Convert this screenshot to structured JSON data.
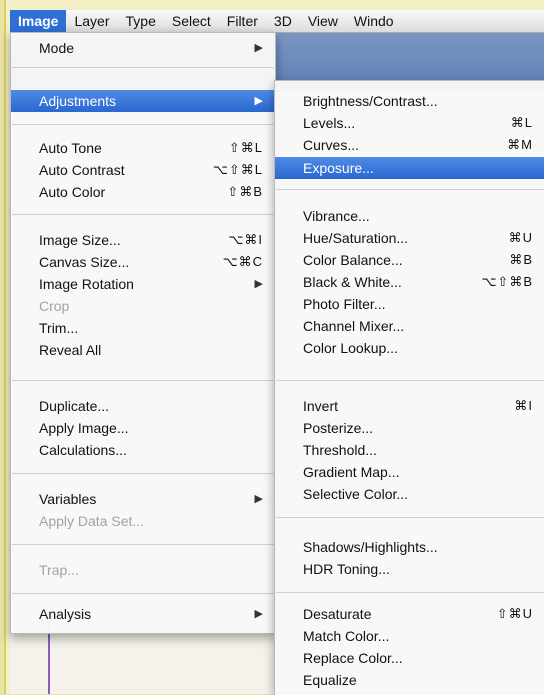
{
  "menubar": {
    "items": [
      "Image",
      "Layer",
      "Type",
      "Select",
      "Filter",
      "3D",
      "View",
      "Windo"
    ]
  },
  "image_menu": {
    "items": [
      {
        "label": "Mode",
        "shortcut": "",
        "submenu": true,
        "disabled": false
      },
      {
        "label": "Adjustments",
        "shortcut": "",
        "submenu": true,
        "disabled": false,
        "highlighted": true
      },
      {
        "label": "Auto Tone",
        "shortcut": "⇧⌘L",
        "submenu": false,
        "disabled": false
      },
      {
        "label": "Auto Contrast",
        "shortcut": "⌥⇧⌘L",
        "submenu": false,
        "disabled": false
      },
      {
        "label": "Auto Color",
        "shortcut": "⇧⌘B",
        "submenu": false,
        "disabled": false
      },
      {
        "label": "Image Size...",
        "shortcut": "⌥⌘I",
        "submenu": false,
        "disabled": false
      },
      {
        "label": "Canvas Size...",
        "shortcut": "⌥⌘C",
        "submenu": false,
        "disabled": false
      },
      {
        "label": "Image Rotation",
        "shortcut": "",
        "submenu": true,
        "disabled": false
      },
      {
        "label": "Crop",
        "shortcut": "",
        "submenu": false,
        "disabled": true
      },
      {
        "label": "Trim...",
        "shortcut": "",
        "submenu": false,
        "disabled": false
      },
      {
        "label": "Reveal All",
        "shortcut": "",
        "submenu": false,
        "disabled": false
      },
      {
        "label": "Duplicate...",
        "shortcut": "",
        "submenu": false,
        "disabled": false
      },
      {
        "label": "Apply Image...",
        "shortcut": "",
        "submenu": false,
        "disabled": false
      },
      {
        "label": "Calculations...",
        "shortcut": "",
        "submenu": false,
        "disabled": false
      },
      {
        "label": "Variables",
        "shortcut": "",
        "submenu": true,
        "disabled": false
      },
      {
        "label": "Apply Data Set...",
        "shortcut": "",
        "submenu": false,
        "disabled": true
      },
      {
        "label": "Trap...",
        "shortcut": "",
        "submenu": false,
        "disabled": true
      },
      {
        "label": "Analysis",
        "shortcut": "",
        "submenu": true,
        "disabled": false
      }
    ]
  },
  "adjustments_menu": {
    "items": [
      {
        "label": "Brightness/Contrast...",
        "shortcut": ""
      },
      {
        "label": "Levels...",
        "shortcut": "⌘L"
      },
      {
        "label": "Curves...",
        "shortcut": "⌘M"
      },
      {
        "label": "Exposure...",
        "shortcut": "",
        "highlighted": true
      },
      {
        "label": "Vibrance...",
        "shortcut": ""
      },
      {
        "label": "Hue/Saturation...",
        "shortcut": "⌘U"
      },
      {
        "label": "Color Balance...",
        "shortcut": "⌘B"
      },
      {
        "label": "Black & White...",
        "shortcut": "⌥⇧⌘B"
      },
      {
        "label": "Photo Filter...",
        "shortcut": ""
      },
      {
        "label": "Channel Mixer...",
        "shortcut": ""
      },
      {
        "label": "Color Lookup...",
        "shortcut": ""
      },
      {
        "label": "Invert",
        "shortcut": "⌘I"
      },
      {
        "label": "Posterize...",
        "shortcut": ""
      },
      {
        "label": "Threshold...",
        "shortcut": ""
      },
      {
        "label": "Gradient Map...",
        "shortcut": ""
      },
      {
        "label": "Selective Color...",
        "shortcut": ""
      },
      {
        "label": "Shadows/Highlights...",
        "shortcut": ""
      },
      {
        "label": "HDR Toning...",
        "shortcut": ""
      },
      {
        "label": "Desaturate",
        "shortcut": "⇧⌘U"
      },
      {
        "label": "Match Color...",
        "shortcut": ""
      },
      {
        "label": "Replace Color...",
        "shortcut": ""
      },
      {
        "label": "Equalize",
        "shortcut": ""
      }
    ]
  },
  "icons": {
    "submenu_arrow": "▶"
  }
}
